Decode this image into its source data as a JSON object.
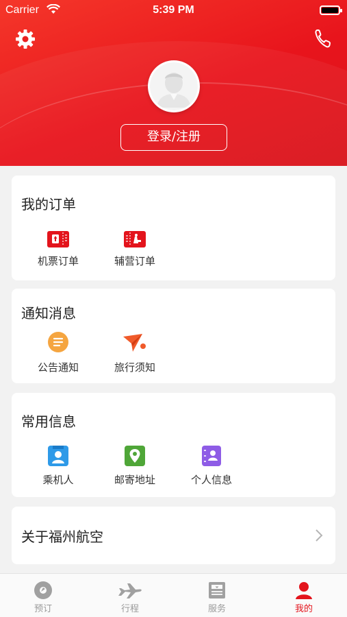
{
  "status_bar": {
    "carrier": "Carrier",
    "time": "5:39 PM"
  },
  "header": {
    "login_label": "登录/注册"
  },
  "orders": {
    "title": "我的订单",
    "items": [
      {
        "label": "机票订单",
        "icon": "ticket-icon"
      },
      {
        "label": "辅营订单",
        "icon": "ancillary-ticket-icon"
      }
    ]
  },
  "notices": {
    "title": "通知消息",
    "items": [
      {
        "label": "公告通知",
        "icon": "announcement-icon"
      },
      {
        "label": "旅行须知",
        "icon": "paper-plane-icon"
      }
    ]
  },
  "common_info": {
    "title": "常用信息",
    "items": [
      {
        "label": "乘机人",
        "icon": "passenger-card-icon"
      },
      {
        "label": "邮寄地址",
        "icon": "map-pin-icon"
      },
      {
        "label": "个人信息",
        "icon": "contact-book-icon"
      }
    ]
  },
  "about": {
    "label": "关于福州航空"
  },
  "tabbar": {
    "tabs": [
      {
        "label": "预订",
        "icon": "booking-icon",
        "active": false
      },
      {
        "label": "行程",
        "icon": "airplane-icon",
        "active": false
      },
      {
        "label": "服务",
        "icon": "service-icon",
        "active": false
      },
      {
        "label": "我的",
        "icon": "user-icon",
        "active": true
      }
    ]
  },
  "colors": {
    "brand_red": "#e3141c",
    "tab_inactive": "#9a9a9a",
    "background": "#f2f2f2"
  }
}
